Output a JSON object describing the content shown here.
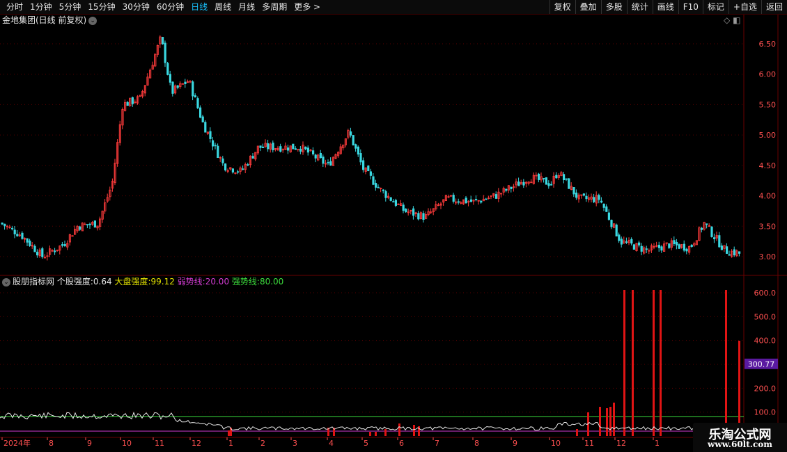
{
  "toolbar": {
    "tabs": [
      "分时",
      "1分钟",
      "5分钟",
      "15分钟",
      "30分钟",
      "60分钟",
      "日线",
      "周线",
      "月线",
      "多周期",
      "更多 >"
    ],
    "active_tab_index": 6,
    "right_buttons": [
      "复权",
      "叠加",
      "多股",
      "统计",
      "画线",
      "F10",
      "标记",
      "+自选",
      "返回"
    ]
  },
  "main_panel": {
    "title": "金地集团(日线 前复权)",
    "y_ticks": [
      "6.50",
      "6.00",
      "5.50",
      "5.00",
      "4.50",
      "4.00",
      "3.50",
      "3.00"
    ]
  },
  "indicator_panel": {
    "name": "股朋指标网",
    "stock_label": "个股强度:",
    "stock_value": "0.64",
    "market_label": "大盘强度:",
    "market_value": "99.12",
    "weak_label": "弱势线:",
    "weak_value": "20.00",
    "strong_label": "强势线:",
    "strong_value": "80.00",
    "y_ticks": [
      "600.0",
      "500.0",
      "400.0",
      "300.0",
      "200.0",
      "100.0"
    ],
    "current_value": "300.77"
  },
  "x_axis": {
    "labels": [
      "2024年",
      "8",
      "9",
      "10",
      "11",
      "12",
      "1",
      "2",
      "3",
      "4",
      "5",
      "6",
      "7",
      "8",
      "9",
      "10",
      "11",
      "12",
      "1"
    ]
  },
  "colors": {
    "up": "#ff3b3b",
    "down": "#3ad7e0",
    "grid": "#5a0000",
    "strong": "#3cdc3c",
    "weak": "#d23cd2",
    "bar": "#e01414",
    "label_market": "#e6e600"
  },
  "watermark": {
    "line1": "乐淘公式网",
    "line2": "www.60lt.com"
  }
}
